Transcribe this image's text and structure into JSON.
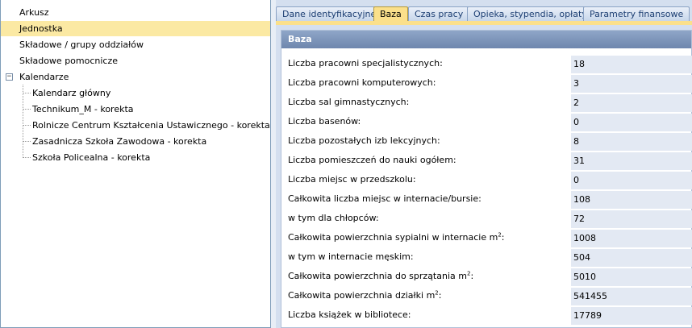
{
  "tree": {
    "items": [
      {
        "label": "Arkusz"
      },
      {
        "label": "Jednostka"
      },
      {
        "label": "Składowe / grupy oddziałów"
      },
      {
        "label": "Składowe pomocnicze"
      },
      {
        "label": "Kalendarze"
      },
      {
        "label": "Kalendarz główny"
      },
      {
        "label": "Technikum_M - korekta"
      },
      {
        "label": "Rolnicze Centrum Kształcenia Ustawicznego - korekta"
      },
      {
        "label": "Zasadnicza Szkoła Zawodowa - korekta"
      },
      {
        "label": "Szkoła Policealna - korekta"
      }
    ],
    "expander_symbol": "−",
    "selected_color": "#fbe9a3"
  },
  "tabs": [
    {
      "label": "Dane identyfikacyjne"
    },
    {
      "label": "Baza"
    },
    {
      "label": "Czas pracy"
    },
    {
      "label": "Opieka, stypendia, opłaty"
    },
    {
      "label": "Parametry finansowe"
    }
  ],
  "panel": {
    "title": "Baza",
    "fields": [
      {
        "label": "Liczba pracowni specjalistycznych:",
        "value": "18"
      },
      {
        "label": "Liczba pracowni komputerowych:",
        "value": "3"
      },
      {
        "label": "Liczba sal gimnastycznych:",
        "value": "2"
      },
      {
        "label": "Liczba basenów:",
        "value": "0"
      },
      {
        "label": "Liczba pozostałych izb lekcyjnych:",
        "value": "8"
      },
      {
        "label": "Liczba pomieszczeń do nauki ogółem:",
        "value": "31"
      },
      {
        "label": "Liczba miejsc w przedszkolu:",
        "value": "0"
      },
      {
        "label": "Całkowita liczba miejsc w internacie/bursie:",
        "value": "108"
      },
      {
        "label": "w tym dla chłopców:",
        "value": "72"
      },
      {
        "label": "Całkowita powierzchnia sypialni w internacie m",
        "sup": "2",
        "suffix": ":",
        "value": "1008"
      },
      {
        "label": "w tym w internacie męskim:",
        "value": "504"
      },
      {
        "label": "Całkowita powierzchnia do sprzątania m",
        "sup": "2",
        "suffix": ":",
        "value": "5010"
      },
      {
        "label": "Całkowita powierzchnia działki m",
        "sup": "2",
        "suffix": ":",
        "value": "541455"
      },
      {
        "label": "Liczba książek w bibliotece:",
        "value": "17789"
      }
    ]
  },
  "colors": {
    "active_tab": "#fbe08b",
    "panel_header": "#7d93b8",
    "value_bg": "#e3e9f3"
  }
}
